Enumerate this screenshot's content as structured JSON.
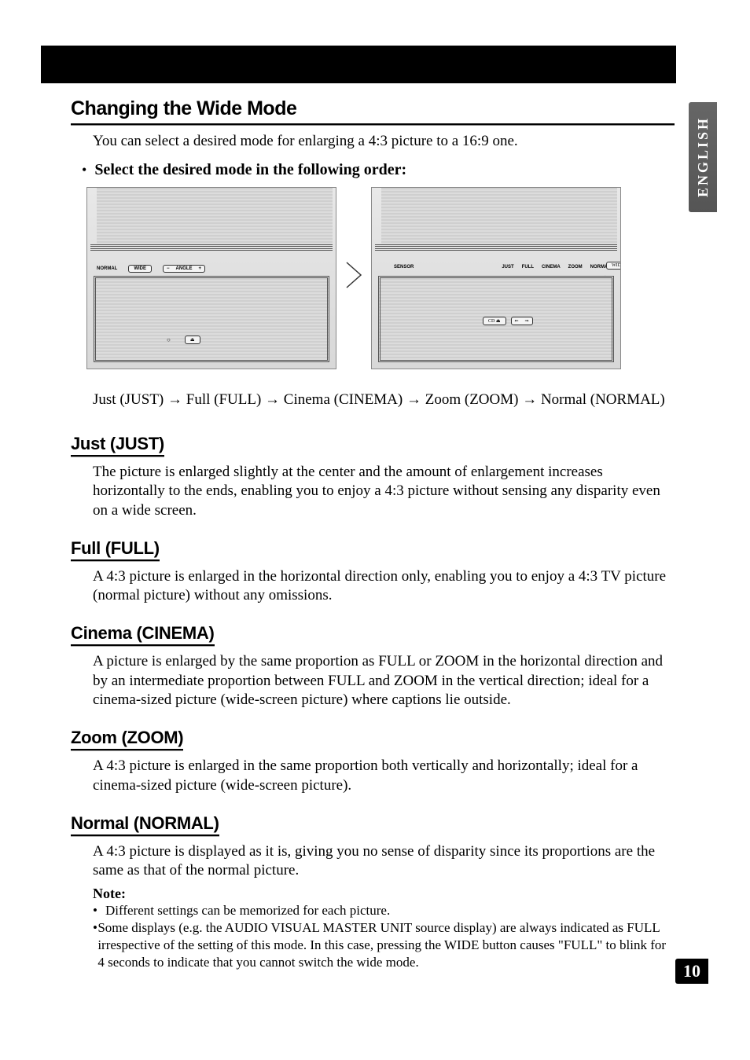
{
  "page": {
    "title": "Changing the Wide Mode",
    "intro": "You can select a desired mode for enlarging a 4:3 picture to a 16:9 one.",
    "bullet": "Select the desired mode in the following order:",
    "order": "Just (JUST) → Full (FULL) → Cinema (CINEMA) → Zoom (ZOOM) → Normal (NORMAL)",
    "page_number": "10",
    "language_tab": "ENGLISH"
  },
  "diagram": {
    "left": {
      "normal": "NORMAL",
      "wide": "WIDE",
      "angle_minus": "−",
      "angle_label": "ANGLE",
      "angle_plus": "+",
      "eject": "⏏"
    },
    "right": {
      "sensor": "SENSOR",
      "modes": [
        "JUST",
        "FULL",
        "CINEMA",
        "ZOOM",
        "NORMAL"
      ],
      "wide_btn": "WID",
      "cd_btn": "CD ⏏"
    }
  },
  "sections": {
    "just": {
      "heading": "Just (JUST)",
      "body": "The picture is enlarged slightly at the center and the amount of enlargement increases horizontally to the ends, enabling you to enjoy a 4:3 picture without sensing any disparity even on a wide screen."
    },
    "full": {
      "heading": "Full (FULL)",
      "body": "A 4:3 picture is enlarged in the horizontal direction only, enabling you to enjoy a 4:3 TV picture (normal picture) without any omissions."
    },
    "cinema": {
      "heading": "Cinema (CINEMA)",
      "body": "A picture is enlarged by the same proportion as FULL or ZOOM in the horizontal direction and by an intermediate proportion between FULL and ZOOM in the vertical direction; ideal for a cinema-sized picture (wide-screen picture) where captions lie outside."
    },
    "zoom": {
      "heading": "Zoom (ZOOM)",
      "body": "A 4:3 picture is enlarged in the same proportion both vertically and horizontally; ideal for a cinema-sized picture (wide-screen picture)."
    },
    "normal": {
      "heading": "Normal (NORMAL)",
      "body": "A 4:3 picture is displayed as it is, giving you no sense of disparity since its proportions are the same as that of the normal picture."
    }
  },
  "note": {
    "heading": "Note:",
    "items": [
      "Different settings can be memorized for each picture.",
      "Some displays (e.g. the AUDIO VISUAL MASTER UNIT source display) are always indicated as FULL irrespective of the setting of this mode. In this case, pressing the WIDE button causes \"FULL\" to blink for 4 seconds to indicate that you cannot switch the wide mode."
    ]
  }
}
